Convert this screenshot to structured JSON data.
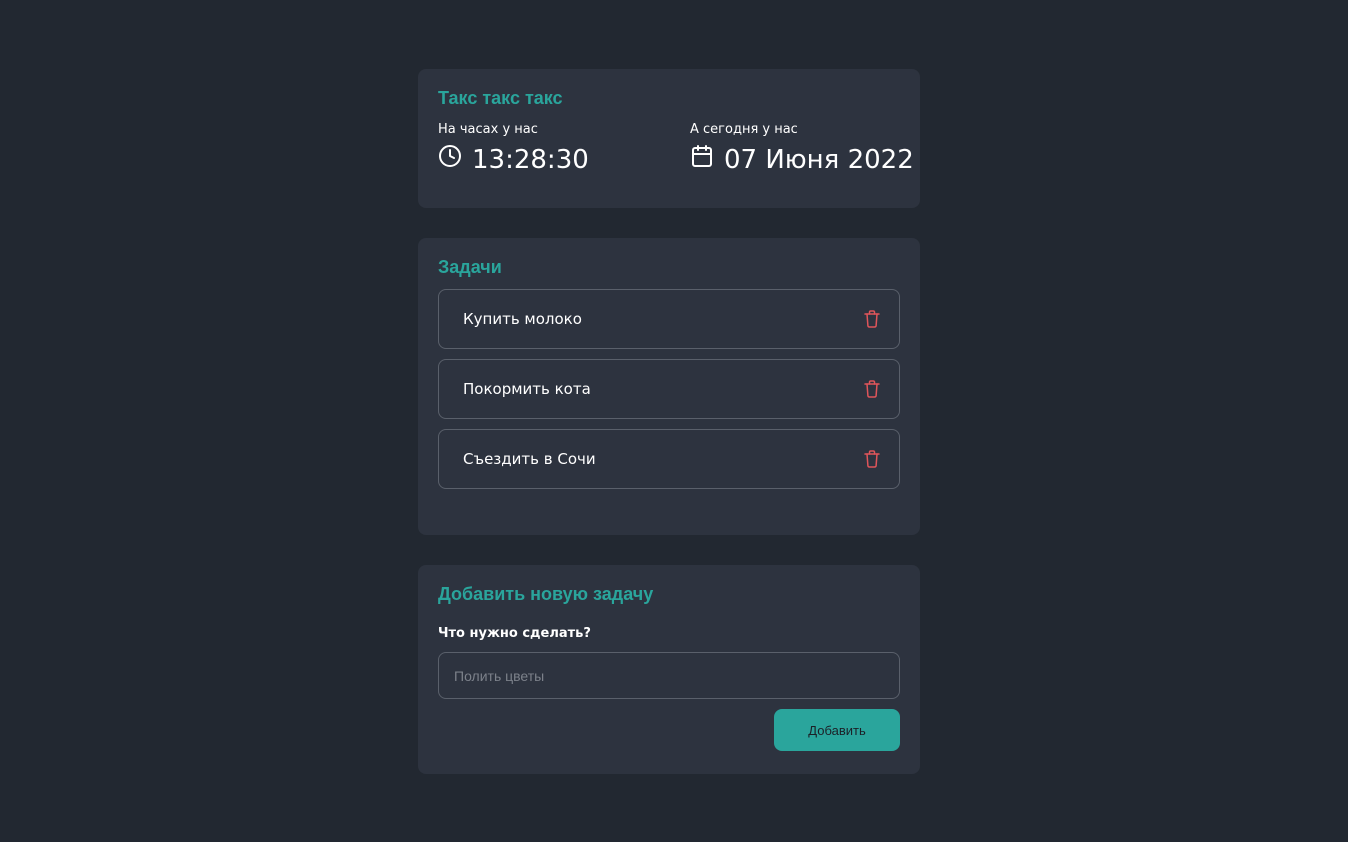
{
  "header": {
    "title": "Такс такс такс",
    "time_label": "На часах у нас",
    "time_value": "13:28:30",
    "date_label": "А сегодня у нас",
    "date_value": "07 Июня 2022"
  },
  "tasks": {
    "title": "Задачи",
    "items": [
      {
        "label": "Купить молоко"
      },
      {
        "label": "Покормить кота"
      },
      {
        "label": "Съездить в Сочи"
      }
    ]
  },
  "add_task": {
    "title": "Добавить новую задачу",
    "field_label": "Что нужно сделать?",
    "placeholder": "Полить цветы",
    "value": "",
    "button_label": "Добавить"
  },
  "icons": {
    "clock": "clock-icon",
    "calendar": "calendar-icon",
    "delete": "trash-icon"
  },
  "colors": {
    "background": "#222831",
    "card": "#2d333f",
    "accent": "#2aa59c",
    "danger": "#e0555a",
    "border": "#5a606b"
  }
}
